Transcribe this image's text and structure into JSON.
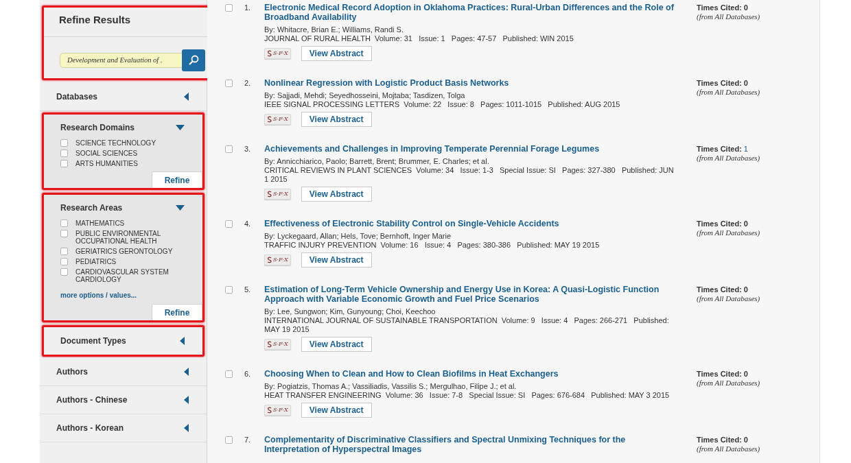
{
  "sidebar": {
    "title": "Refine Results",
    "title_highlighted": true,
    "search": {
      "value": "Development and Evaluation of ."
    },
    "sections": [
      {
        "title": "Databases",
        "expanded": false,
        "highlighted": false
      },
      {
        "title": "Research Domains",
        "expanded": true,
        "highlighted": true,
        "options": [
          {
            "label": "SCIENCE TECHNOLOGY",
            "checked": false
          },
          {
            "label": "SOCIAL SCIENCES",
            "checked": false
          },
          {
            "label": "ARTS HUMANITIES",
            "checked": false
          }
        ],
        "refine": "Refine"
      },
      {
        "title": "Research Areas",
        "expanded": true,
        "highlighted": true,
        "options": [
          {
            "label": "MATHEMATICS",
            "checked": false
          },
          {
            "label": "PUBLIC ENVIRONMENTAL OCCUPATIONAL HEALTH",
            "checked": false
          },
          {
            "label": "GERIATRICS GERONTOLOGY",
            "checked": false
          },
          {
            "label": "PEDIATRICS",
            "checked": false
          },
          {
            "label": "CARDIOVASCULAR SYSTEM CARDIOLOGY",
            "checked": false
          }
        ],
        "more": "more options / values...",
        "refine": "Refine"
      },
      {
        "title": "Document Types",
        "expanded": false,
        "highlighted": true
      },
      {
        "title": "Authors",
        "expanded": false,
        "highlighted": false
      },
      {
        "title": "Authors - Chinese",
        "expanded": false,
        "highlighted": false
      },
      {
        "title": "Authors - Korean",
        "expanded": false,
        "highlighted": false
      }
    ]
  },
  "results": [
    {
      "number": "1.",
      "checked": false,
      "title": "Electronic Medical Record Adoption in Oklahoma Practices: Rural-Urban Differences and the Role of Broadband Availability",
      "authors": "By: Whitacre, Brian E.; Williams, Randi S.",
      "source": "JOURNAL OF RURAL HEALTH  Volume: 31   Issue: 1   Pages: 47-57   Published: WIN 2015",
      "sfx": "S·F·X",
      "button": "View Abstract",
      "cited_label": "Times Cited:",
      "cited": "0",
      "cited_linked": false,
      "cited_note": "(from All Databases)"
    },
    {
      "number": "2.",
      "checked": false,
      "title": "Nonlinear Regression with Logistic Product Basis Networks",
      "authors": "By: Sajjadi, Mehdi; Seyedhosseini, Mojtaba; Tasdizen, Tolga",
      "source": "IEEE SIGNAL PROCESSING LETTERS  Volume: 22   Issue: 8   Pages: 1011-1015   Published: AUG 2015",
      "sfx": "S·F·X",
      "button": "View Abstract",
      "cited_label": "Times Cited:",
      "cited": "0",
      "cited_linked": false,
      "cited_note": "(from All Databases)"
    },
    {
      "number": "3.",
      "checked": false,
      "title": "Achievements and Challenges in Improving Temperate Perennial Forage Legumes",
      "authors": "By: Annicchiarico, Paolo; Barrett, Brent; Brummer, E. Charles; et al.",
      "source": "CRITICAL REVIEWS IN PLANT SCIENCES  Volume: 34   Issue: 1-3   Special Issue: SI   Pages: 327-380   Published: JUN 1 2015",
      "sfx": "S·F·X",
      "button": "View Abstract",
      "cited_label": "Times Cited:",
      "cited": "1",
      "cited_linked": true,
      "cited_note": "(from All Databases)"
    },
    {
      "number": "4.",
      "checked": false,
      "title": "Effectiveness of Electronic Stability Control on Single-Vehicle Accidents",
      "authors": "By: Lyckegaard, Allan; Hels, Tove; Bernhoft, Inger Marie",
      "source": "TRAFFIC INJURY PREVENTION  Volume: 16   Issue: 4   Pages: 380-386   Published: MAY 19 2015",
      "sfx": "S·F·X",
      "button": "View Abstract",
      "cited_label": "Times Cited:",
      "cited": "0",
      "cited_linked": false,
      "cited_note": "(from All Databases)"
    },
    {
      "number": "5.",
      "checked": false,
      "title": "Estimation of Long-Term Vehicle Ownership and Energy Use in Korea: A Quasi-Logistic Function Approach with Variable Economic Growth and Fuel Price Scenarios",
      "authors": "By: Lee, Sungwon; Kim, Gunyoung; Choi, Keechoo",
      "source": "INTERNATIONAL JOURNAL OF SUSTAINABLE TRANSPORTATION  Volume: 9   Issue: 4   Pages: 266-271   Published: MAY 19 2015",
      "sfx": "S·F·X",
      "button": "View Abstract",
      "cited_label": "Times Cited:",
      "cited": "0",
      "cited_linked": false,
      "cited_note": "(from All Databases)"
    },
    {
      "number": "6.",
      "checked": false,
      "title": "Choosing When to Clean and How to Clean Biofilms in Heat Exchangers",
      "authors": "By: Pogiatzis, Thomas A.; Vassiliadis, Vassilis S.; Mergulhao, Filipe J.; et al.",
      "source": "HEAT TRANSFER ENGINEERING  Volume: 36   Issue: 7-8   Special Issue: SI   Pages: 676-684   Published: MAY 3 2015",
      "sfx": "S·F·X",
      "button": "View Abstract",
      "cited_label": "Times Cited:",
      "cited": "0",
      "cited_linked": false,
      "cited_note": "(from All Databases)"
    },
    {
      "number": "7.",
      "checked": false,
      "title": "Complementarity of Discriminative Classifiers and Spectral Unmixing Techniques for the Interpretation of Hyperspectral Images",
      "cited_label": "Times Cited:",
      "cited": "0",
      "cited_linked": false,
      "cited_note": "(from All Databases)"
    }
  ]
}
